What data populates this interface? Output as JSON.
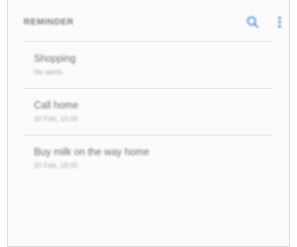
{
  "app_bar": {
    "title": "REMINDER",
    "icons": [
      "search-icon",
      "more-vertical-icon"
    ],
    "accent_color": "#3f7ed6"
  },
  "reminders": [
    {
      "title": "Shopping",
      "subtitle": "No alerts"
    },
    {
      "title": "Call home",
      "subtitle": "20 Feb, 15:00"
    },
    {
      "title": "Buy milk on the way home",
      "subtitle": "20 Feb, 18:00"
    }
  ]
}
